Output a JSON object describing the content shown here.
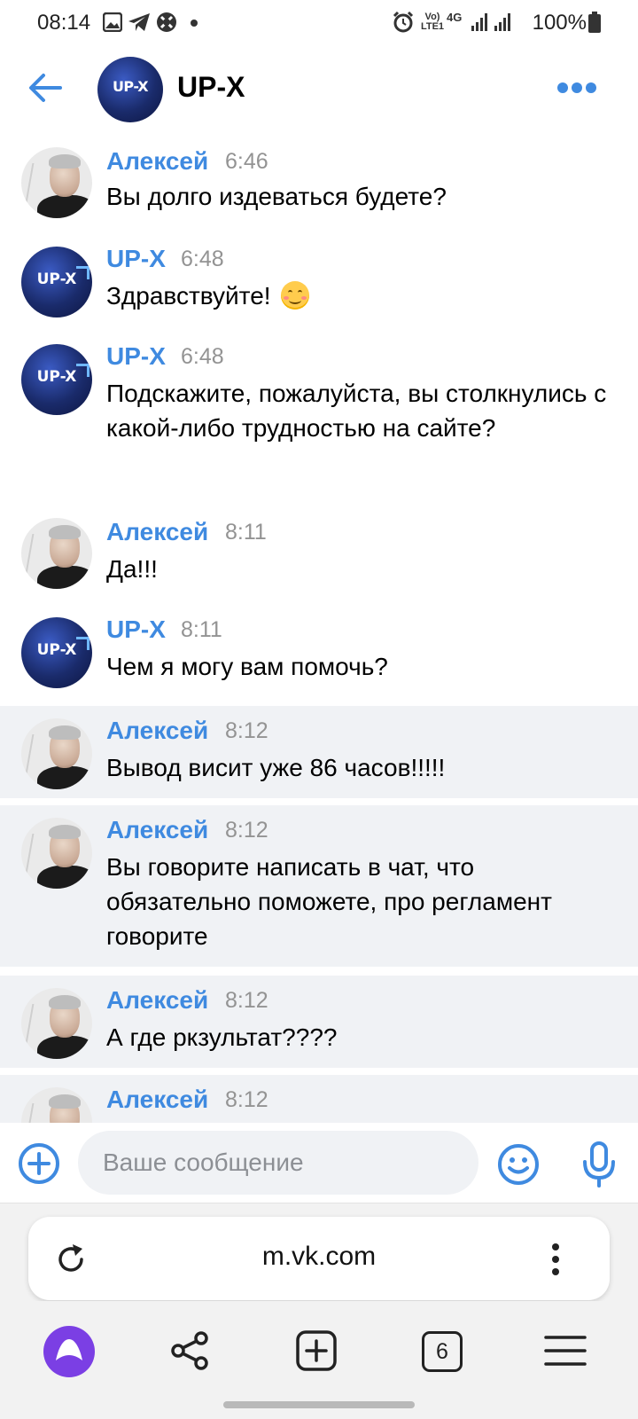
{
  "status_bar": {
    "time": "08:14",
    "network": "4G",
    "volte": "Vo) LTE1",
    "battery": "100%"
  },
  "header": {
    "title": "UP-X",
    "avatar_label": "UP-X"
  },
  "messages": [
    {
      "author": "Алексей",
      "time": "6:46",
      "text": "Вы долго издеваться будете?",
      "type": "person"
    },
    {
      "author": "UP-X",
      "time": "6:48",
      "text": "Здравствуйте!",
      "emoji": "smiling-face",
      "type": "group"
    },
    {
      "author": "UP-X",
      "time": "6:48",
      "text": "Подскажите, пожалуйста, вы столкнулись с какой-либо трудностью на сайте?",
      "type": "group"
    },
    {
      "author": "Алексей",
      "time": "8:11",
      "text": "Да!!!",
      "type": "person"
    },
    {
      "author": "UP-X",
      "time": "8:11",
      "text": "Чем я могу вам помочь?",
      "type": "group"
    },
    {
      "author": "Алексей",
      "time": "8:12",
      "text": "Вывод висит уже 86 часов!!!!!",
      "type": "person",
      "unread": true
    },
    {
      "author": "Алексей",
      "time": "8:12",
      "text": "Вы говорите написать в чат, что обязательно поможете, про регламент говорите",
      "type": "person",
      "unread": true
    },
    {
      "author": "Алексей",
      "time": "8:12",
      "text": "А где ркзультат????",
      "type": "person",
      "unread": true
    },
    {
      "author": "Алексей",
      "time": "8:12",
      "text": "",
      "type": "person",
      "unread": true
    }
  ],
  "composer": {
    "placeholder": "Ваше сообщение"
  },
  "browser": {
    "url": "m.vk.com",
    "tab_count": "6"
  },
  "colors": {
    "accent": "#3f8ae0",
    "unread_bg": "#f0f2f5",
    "alice": "#7b3fe4"
  }
}
